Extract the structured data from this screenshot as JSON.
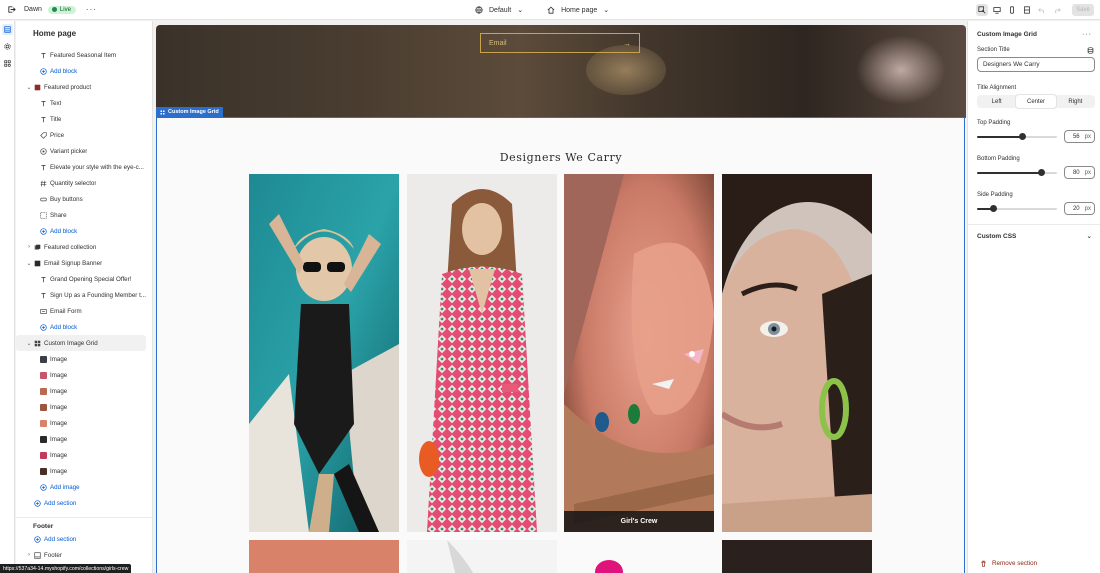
{
  "topbar": {
    "theme_name": "Dawn",
    "status": "Live",
    "template": "Default",
    "page": "Home page",
    "save_label": "Save"
  },
  "sidebar": {
    "title": "Home page",
    "rows": [
      {
        "level": 2,
        "icon": "text-icon",
        "label": "Featured Seasonal Item"
      },
      {
        "level": 2,
        "icon": "add-icon",
        "label": "Add block",
        "add": true
      },
      {
        "level": 1,
        "icon": "product-icon",
        "label": "Featured product",
        "expanded": true
      },
      {
        "level": 2,
        "icon": "text-icon",
        "label": "Text"
      },
      {
        "level": 2,
        "icon": "text-icon",
        "label": "Title"
      },
      {
        "level": 2,
        "icon": "price-tag-icon",
        "label": "Price"
      },
      {
        "level": 2,
        "icon": "variant-icon",
        "label": "Variant picker"
      },
      {
        "level": 2,
        "icon": "text-icon",
        "label": "Elevate your style with the eye-c..."
      },
      {
        "level": 2,
        "icon": "hash-icon",
        "label": "Quantity selector"
      },
      {
        "level": 2,
        "icon": "button-icon",
        "label": "Buy buttons"
      },
      {
        "level": 2,
        "icon": "share-icon",
        "label": "Share"
      },
      {
        "level": 2,
        "icon": "add-icon",
        "label": "Add block",
        "add": true
      },
      {
        "level": 1,
        "icon": "collection-icon",
        "label": "Featured collection"
      },
      {
        "level": 1,
        "icon": "email-banner-icon",
        "label": "Email Signup Banner",
        "expanded": true
      },
      {
        "level": 2,
        "icon": "text-icon",
        "label": "Grand Opening Special Offer!"
      },
      {
        "level": 2,
        "icon": "text-icon",
        "label": "Sign Up as a Founding Member t..."
      },
      {
        "level": 2,
        "icon": "form-icon",
        "label": "Email Form"
      },
      {
        "level": 2,
        "icon": "add-icon",
        "label": "Add block",
        "add": true
      },
      {
        "level": 1,
        "icon": "grid-icon",
        "label": "Custom Image Grid",
        "expanded": true,
        "selected": true
      },
      {
        "level": 2,
        "icon": "image-thumb-1",
        "label": "Image",
        "thumb": "#3b3f45"
      },
      {
        "level": 2,
        "icon": "image-thumb-2",
        "label": "Image",
        "thumb": "#c7546b"
      },
      {
        "level": 2,
        "icon": "image-thumb-3",
        "label": "Image",
        "thumb": "#b86b4f"
      },
      {
        "level": 2,
        "icon": "image-thumb-4",
        "label": "Image",
        "thumb": "#9c5640"
      },
      {
        "level": 2,
        "icon": "image-thumb-5",
        "label": "Image",
        "thumb": "#d9826a"
      },
      {
        "level": 2,
        "icon": "image-thumb-6",
        "label": "Image",
        "thumb": "#2a2a2a"
      },
      {
        "level": 2,
        "icon": "image-thumb-7",
        "label": "Image",
        "thumb": "#c23b5a"
      },
      {
        "level": 2,
        "icon": "image-thumb-8",
        "label": "Image",
        "thumb": "#4a2e28"
      },
      {
        "level": 2,
        "icon": "add-icon",
        "label": "Add image",
        "add": true
      },
      {
        "level": 1,
        "icon": "add-icon",
        "label": "Add section",
        "add": true
      }
    ],
    "footer_heading": "Footer",
    "footer_rows": [
      {
        "level": 1,
        "icon": "add-icon",
        "label": "Add section",
        "add": true
      },
      {
        "level": 1,
        "icon": "footer-icon",
        "label": "Footer"
      }
    ]
  },
  "url_status": "https://537a34-14.myshopify.com/collections/girls-crew",
  "preview": {
    "email_placeholder": "Email",
    "section_tag": "Custom Image Grid",
    "grid_title": "Designers We Carry",
    "images": [
      {
        "alt": "Woman in black swimsuit and sunglasses by pool",
        "caption": ""
      },
      {
        "alt": "Woman in pink patterned kaftan dress",
        "caption": ""
      },
      {
        "alt": "Ear with multiple jeweled earrings",
        "caption": "Girl's Crew"
      },
      {
        "alt": "Woman wearing green hoop earring",
        "caption": ""
      }
    ]
  },
  "settings": {
    "title": "Custom Image Grid",
    "section_title_label": "Section Title",
    "section_title_value": "Designers We Carry",
    "alignment_label": "Title Alignment",
    "alignment_options": [
      "Left",
      "Center",
      "Right"
    ],
    "alignment_selected": "Center",
    "top_padding_label": "Top Padding",
    "top_padding": 56,
    "bottom_padding_label": "Bottom Padding",
    "bottom_padding": 80,
    "side_padding_label": "Side Padding",
    "side_padding": 20,
    "padding_unit": "px",
    "padding_max": 100,
    "custom_css_label": "Custom CSS",
    "remove_label": "Remove section"
  },
  "colors": {
    "accent": "#2c6ecb",
    "live_badge": "#cdf5d4",
    "remove": "#8e1f0b",
    "email_border": "#c9a24a"
  }
}
